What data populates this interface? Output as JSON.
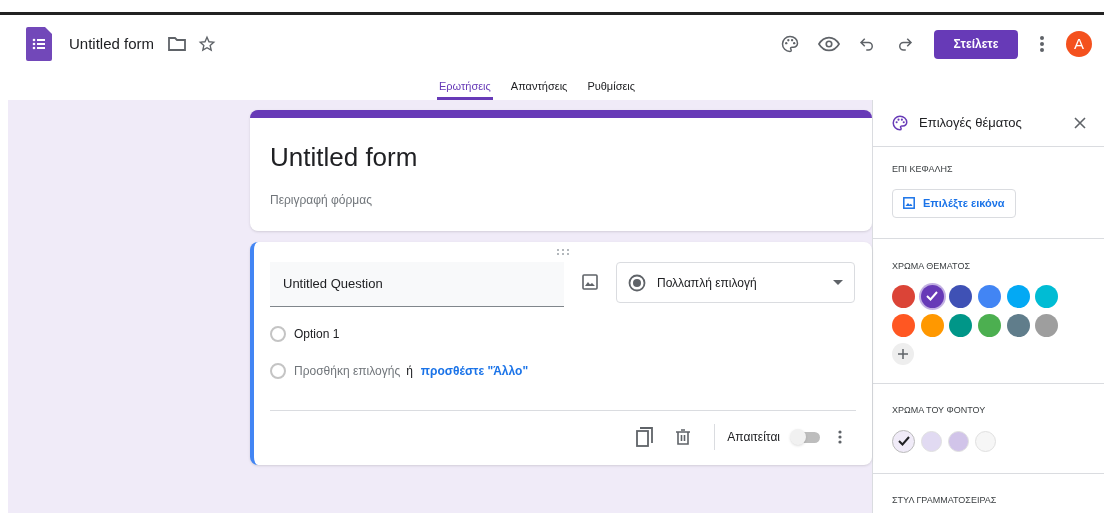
{
  "header": {
    "title": "Untitled form",
    "send_button": "Στείλετε",
    "avatar": "A"
  },
  "tabs": [
    {
      "label": "Ερωτήσεις",
      "selected": true
    },
    {
      "label": "Απαντήσεις",
      "selected": false
    },
    {
      "label": "Ρυθμίσεις",
      "selected": false
    }
  ],
  "form": {
    "title": "Untitled form",
    "description": "Περιγραφή φόρμας"
  },
  "question": {
    "title": "Untitled Question",
    "type": "Πολλαπλή επιλογή",
    "options": [
      "Option 1"
    ],
    "add_option": "Προσθήκη επιλογής",
    "or": "ή",
    "add_other": "προσθέστε \"Άλλο\"",
    "required_label": "Απαιτείται",
    "required": false
  },
  "theme_panel": {
    "title": "Επιλογές θέματος",
    "header_label": "ΕΠΙ ΚΕΦΑΛΗΣ",
    "choose_image": "Επιλέξτε εικόνα",
    "theme_color_label": "ΧΡΩΜΑ ΘΕΜΑΤΟΣ",
    "theme_colors": [
      {
        "color": "#db4437",
        "selected": false
      },
      {
        "color": "#673ab7",
        "selected": true
      },
      {
        "color": "#3f51b5",
        "selected": false
      },
      {
        "color": "#4285f4",
        "selected": false
      },
      {
        "color": "#03a9f4",
        "selected": false
      },
      {
        "color": "#00bcd4",
        "selected": false
      },
      {
        "color": "#ff5722",
        "selected": false
      },
      {
        "color": "#ff9800",
        "selected": false
      },
      {
        "color": "#009688",
        "selected": false
      },
      {
        "color": "#4caf50",
        "selected": false
      },
      {
        "color": "#607d8b",
        "selected": false
      },
      {
        "color": "#9e9e9e",
        "selected": false
      }
    ],
    "background_label": "ΧΡΩΜΑ ΤΟΥ ΦΟΝΤΟΥ",
    "background_colors": [
      {
        "color": "#f0ebf8",
        "selected": true
      },
      {
        "color": "#e1daf2",
        "selected": false
      },
      {
        "color": "#d1c4e9",
        "selected": false
      },
      {
        "color": "#f6f6f6",
        "selected": false
      }
    ],
    "font_style_label": "ΣΤΥΛ ΓΡΑΜΜΑΤΟΣΕΙΡΑΣ"
  }
}
